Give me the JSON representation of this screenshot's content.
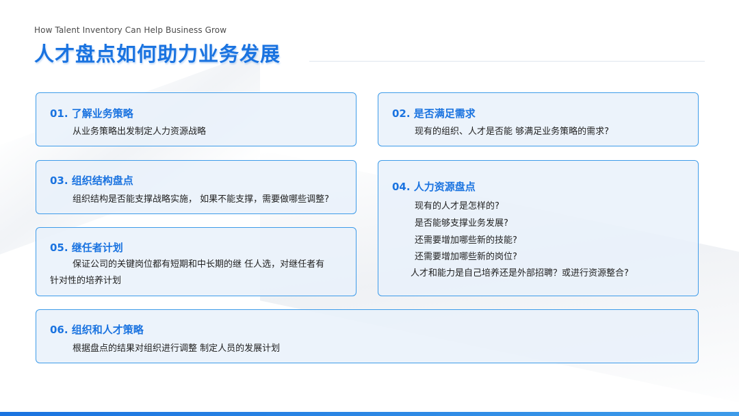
{
  "header": {
    "subtitle": "How Talent Inventory Can Help Business Grow",
    "title": "人才盘点如何助力业务发展"
  },
  "cards": [
    {
      "title": "01.  了解业务策略",
      "lines": [
        "从业务策略出发制定人力资源战略"
      ]
    },
    {
      "title": "02.  是否满足需求",
      "lines": [
        "现有的组织、人才是否能 够满足业务策略的需求?"
      ]
    },
    {
      "title": "03.  组织结构盘点",
      "lines": [
        "组织结构是否能支撑战略实施， 如果不能支撑，需要做哪些调整?"
      ]
    },
    {
      "title": "04.  人力资源盘点",
      "lines": [
        "现有的人才是怎样的?",
        "是否能够支撑业务发展?",
        "还需要增加哪些新的技能?",
        "还需要增加哪些新的岗位?",
        "人才和能力是自己培养还是外部招聘？或进行资源整合?"
      ]
    },
    {
      "title": "05.  继任者计划",
      "lines": [
        "保证公司的关键岗位都有短期和中长期的继 任人选，对继任者有",
        "针对性的培养计划"
      ]
    },
    {
      "title": "06.  组织和人才策略",
      "lines": [
        "根据盘点的结果对组织进行调整 制定人员的发展计划"
      ]
    }
  ],
  "colors": {
    "accent": "#1a73e0",
    "card_border": "#3d9be9",
    "card_fill": "#e9f1fa"
  }
}
